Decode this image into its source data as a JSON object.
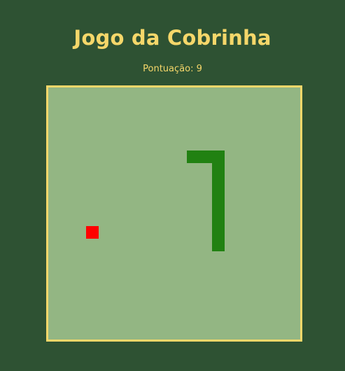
{
  "title": "Jogo da Cobrinha",
  "score_text": "Pontuação: 9",
  "score": 9,
  "colors": {
    "background": "#2e5233",
    "text": "#f5d76a",
    "board": "#93b683",
    "board_border": "#f5d76a",
    "snake": "#218112",
    "food": "#ff0000"
  },
  "grid": {
    "columns": 20,
    "rows": 20
  },
  "snake": [
    {
      "col": 13,
      "row": 5
    },
    {
      "col": 12,
      "row": 5
    },
    {
      "col": 11,
      "row": 5
    },
    {
      "col": 13,
      "row": 6
    },
    {
      "col": 13,
      "row": 7
    },
    {
      "col": 13,
      "row": 8
    },
    {
      "col": 13,
      "row": 9
    },
    {
      "col": 13,
      "row": 10
    },
    {
      "col": 13,
      "row": 11
    },
    {
      "col": 13,
      "row": 12
    }
  ],
  "food": {
    "col": 3,
    "row": 11
  }
}
